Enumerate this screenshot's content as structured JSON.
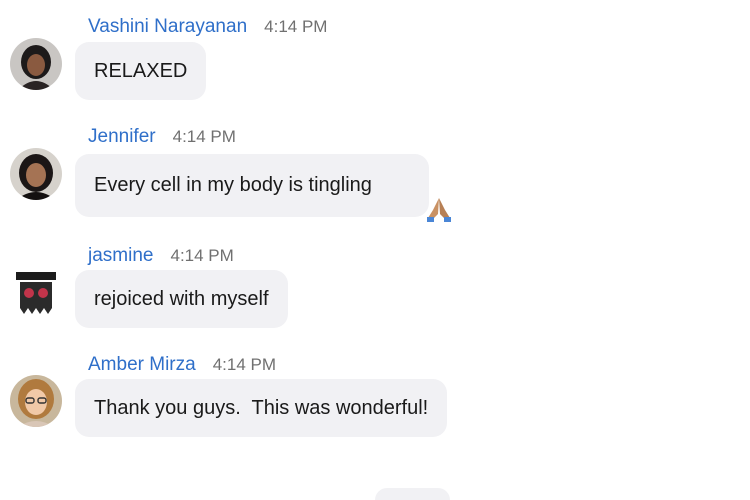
{
  "messages": [
    {
      "sender": "Vashini Narayanan",
      "time": "4:14 PM",
      "text": "RELAXED",
      "avatar": "avatar-woman-dark-hair"
    },
    {
      "sender": "Jennifer",
      "time": "4:14 PM",
      "text": "Every cell in my body is tingling",
      "emoji": "folded-hands-icon",
      "avatar": "avatar-woman-dark-hair"
    },
    {
      "sender": "jasmine",
      "time": "4:14 PM",
      "text": "rejoiced with myself",
      "avatar": "avatar-graphic-logo"
    },
    {
      "sender": "Amber Mirza",
      "time": "4:14 PM",
      "text": "Thank you guys.  This was wonderful!",
      "avatar": "avatar-woman-glasses"
    }
  ],
  "colors": {
    "sender_name": "#2f6fc9",
    "timestamp": "#707070",
    "bubble_bg": "#f1f1f4",
    "message_text": "#1a1a1a"
  }
}
